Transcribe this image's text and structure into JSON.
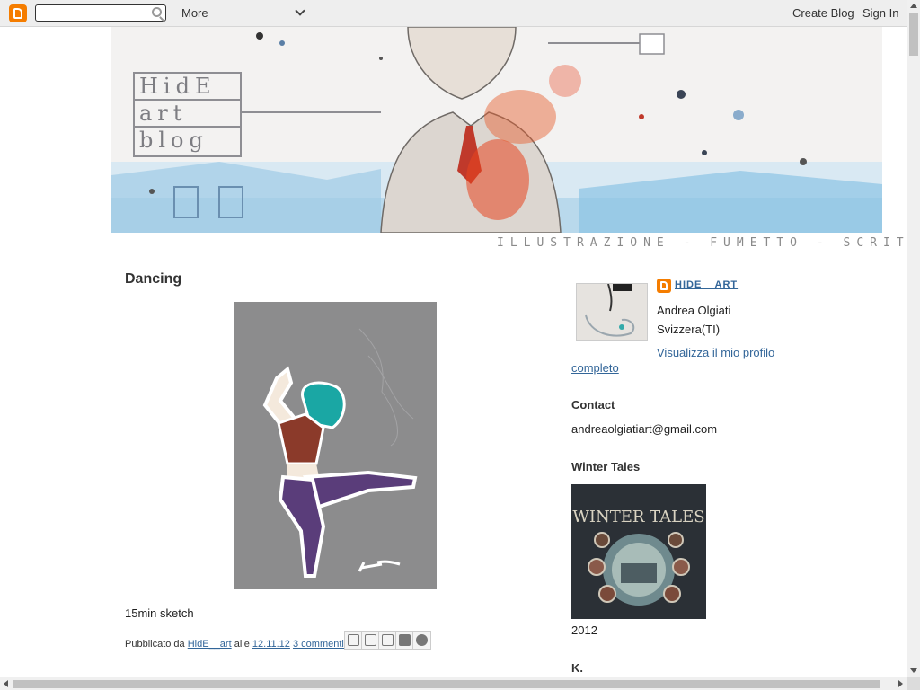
{
  "navbar": {
    "more_label": "More",
    "create_blog": "Create Blog",
    "sign_in": "Sign In",
    "search_placeholder": ""
  },
  "header": {
    "logo_line1": "HidE",
    "logo_line2": "art",
    "logo_line3": "blog",
    "tagline": "ILLUSTRAZIONE - FUMETTO - SCRITTURA"
  },
  "post": {
    "title": "Dancing",
    "body": "15min sketch",
    "footer": {
      "published_by": "Pubblicato da",
      "author": "HidE__art",
      "at": "alle",
      "time": "12.11.12",
      "comments": "3 commenti:"
    }
  },
  "sidebar": {
    "profile": {
      "display_name": "HIDE__ART",
      "real_name": "Andrea Olgiati",
      "location": "Svizzera(TI)",
      "link_part1": "Visualizza il mio profilo",
      "link_part2": "completo"
    },
    "contact": {
      "heading": "Contact",
      "email": "andreaolgiatiart@gmail.com"
    },
    "winter_tales": {
      "heading": "Winter Tales",
      "image_title": "WINTER TALES",
      "caption": "2012"
    },
    "next_heading": "K."
  },
  "colors": {
    "navbar_bg": "#eeeeee",
    "blogger_orange": "#f57d00",
    "link": "#336699",
    "text": "#333333"
  }
}
